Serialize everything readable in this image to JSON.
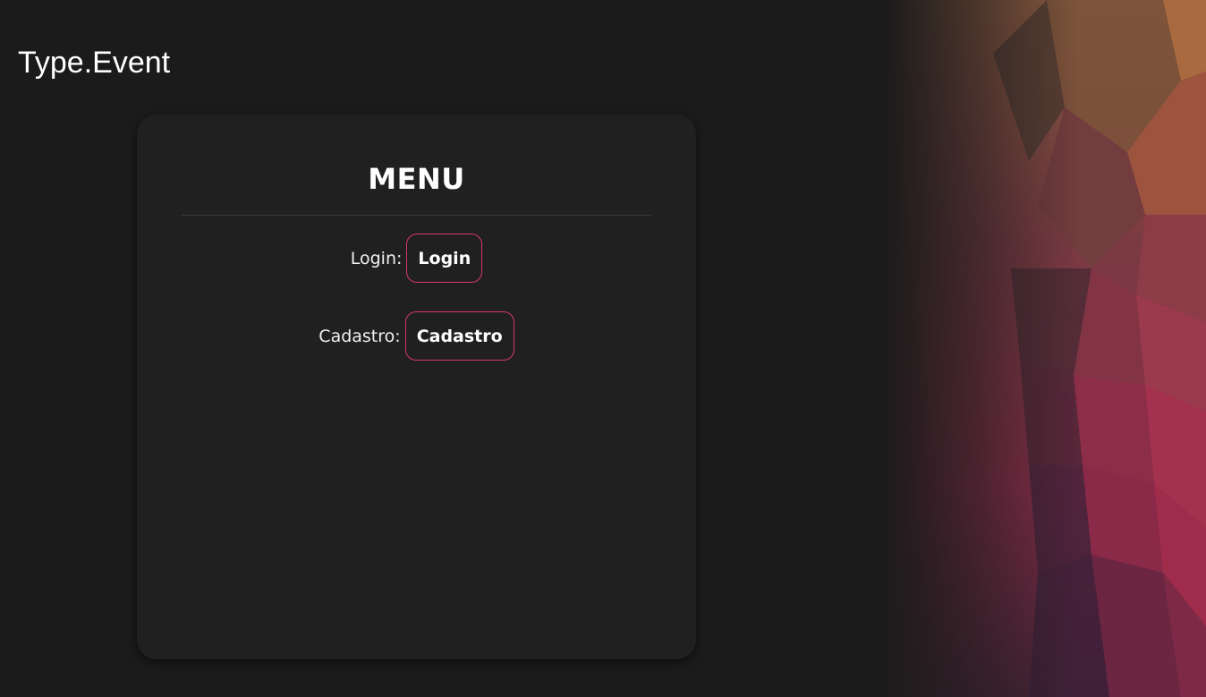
{
  "header": {
    "brand": "Type.Event"
  },
  "menu": {
    "title": "MENU",
    "rows": [
      {
        "label": "Login:",
        "button": "Login"
      },
      {
        "label": "Cadastro:",
        "button": "Cadastro"
      }
    ]
  },
  "colors": {
    "background": "#1c1b1b",
    "card": "#202020",
    "button_border": "#d8386a"
  }
}
